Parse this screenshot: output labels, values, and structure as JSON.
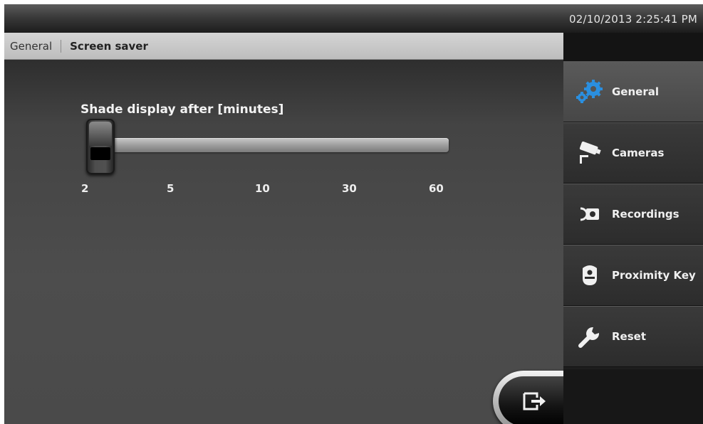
{
  "status_bar": {
    "datetime": "02/10/2013 2:25:41 PM"
  },
  "breadcrumb": {
    "parent": "General",
    "current": "Screen saver"
  },
  "setting": {
    "label": "Shade display after [minutes]",
    "options": [
      "2",
      "5",
      "10",
      "30",
      "60"
    ],
    "selected": "2"
  },
  "sidebar": {
    "items": [
      {
        "label": "General",
        "icon": "gears-icon",
        "active": true
      },
      {
        "label": "Cameras",
        "icon": "security-camera-icon",
        "active": false
      },
      {
        "label": "Recordings",
        "icon": "recording-icon",
        "active": false
      },
      {
        "label": "Proximity Key",
        "icon": "key-fob-icon",
        "active": false
      },
      {
        "label": "Reset",
        "icon": "wrench-icon",
        "active": false
      }
    ]
  },
  "exit_button": {
    "icon": "exit-arrow-icon"
  },
  "colors": {
    "accent_blue": "#2a8fe0",
    "active_item": "#555555"
  }
}
